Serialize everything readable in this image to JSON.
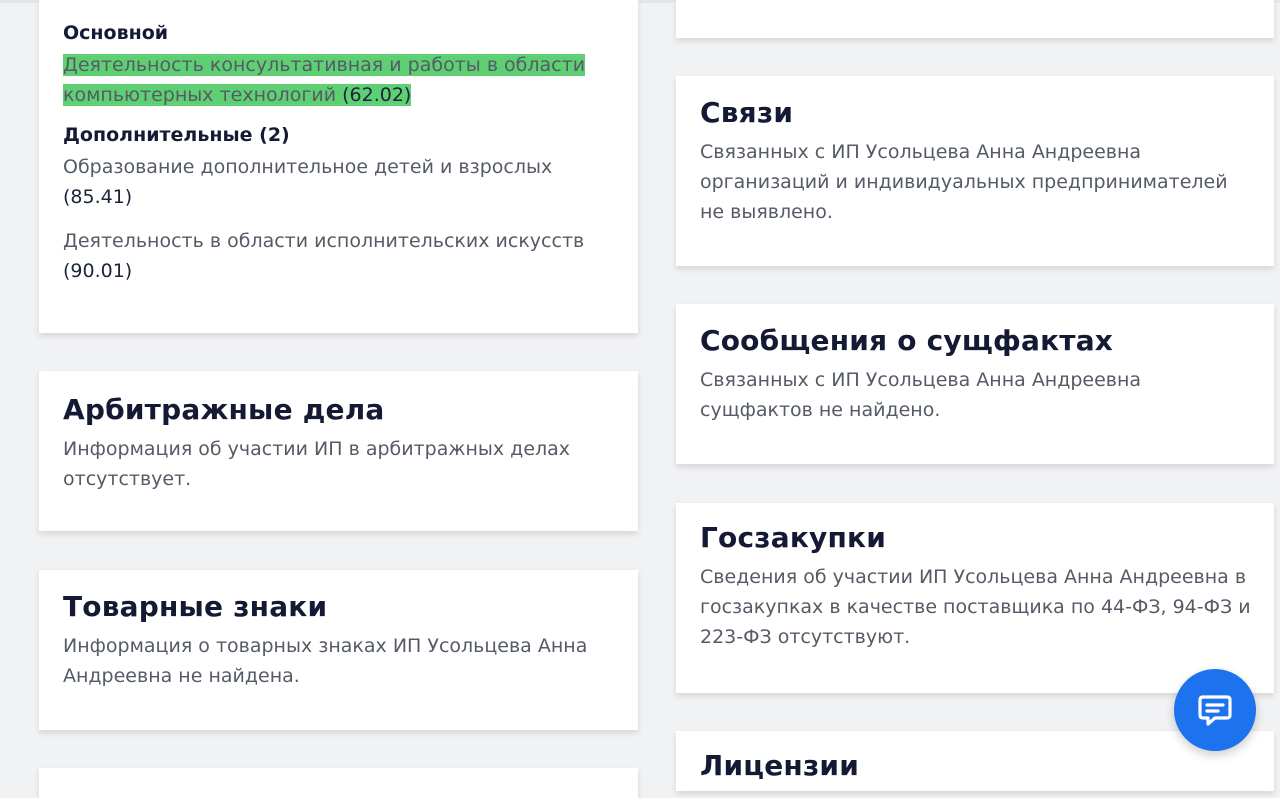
{
  "okved": {
    "main_heading": "Основной",
    "main_text": "Деятельность консультативная и работы в области компьютерных технологий",
    "main_code": "(62.02)",
    "additional_heading": "Дополнительные (2)",
    "additional": [
      {
        "text": "Образование дополнительное детей и взрослых",
        "code": "(85.41)"
      },
      {
        "text": "Деятельность в области исполнительских искусств",
        "code": "(90.01)"
      }
    ]
  },
  "arbitration": {
    "title": "Арбитражные дела",
    "text": "Информация об участии ИП в арбитражных делах отсутствует."
  },
  "trademarks": {
    "title": "Товарные знаки",
    "text": "Информация о товарных знаках ИП Усольцева Анна Андреевна не найдена."
  },
  "links": {
    "title": "Связи",
    "text": "Связанных с ИП Усольцева Анна Андреевна организаций и индивидуальных предпринимателей не выявлено."
  },
  "facts": {
    "title": "Сообщения о сущфактах",
    "text": "Связанных с ИП Усольцева Анна Андреевна сущфактов не найдено."
  },
  "procurement": {
    "title": "Госзакупки",
    "text": "Сведения об участии ИП Усольцева Анна Андреевна в госзакупках в качестве поставщика по 44-ФЗ, 94-ФЗ и 223-ФЗ отсутствуют."
  },
  "licenses": {
    "title": "Лицензии"
  },
  "chat": {
    "icon": "chat-bubble-icon",
    "color": "#1d72ee"
  }
}
